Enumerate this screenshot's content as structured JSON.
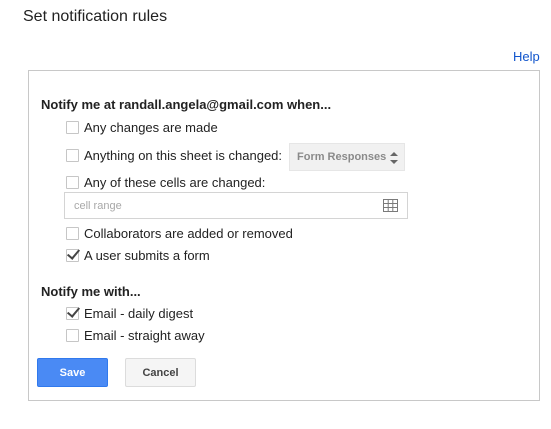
{
  "header": {
    "title": "Set notification rules",
    "help": "Help"
  },
  "notify_when": {
    "heading": "Notify me at randall.angela@gmail.com when...",
    "options": [
      {
        "label": "Any changes are made",
        "checked": false
      },
      {
        "label": "Anything on this sheet is changed:",
        "checked": false
      },
      {
        "label": "Any of these cells are changed:",
        "checked": false
      },
      {
        "label": "Collaborators are added or removed",
        "checked": false
      },
      {
        "label": "A user submits a form",
        "checked": true
      }
    ],
    "sheet_select": {
      "value": "Form Responses"
    },
    "cell_range": {
      "placeholder": "cell range",
      "value": ""
    }
  },
  "notify_with": {
    "heading": "Notify me with...",
    "options": [
      {
        "label": "Email - daily digest",
        "checked": true
      },
      {
        "label": "Email - straight away",
        "checked": false
      }
    ]
  },
  "buttons": {
    "save": "Save",
    "cancel": "Cancel"
  },
  "colors": {
    "primary": "#4a8af4",
    "link": "#1155cc"
  },
  "icons": {
    "select_arrows": "up-down-arrows-icon",
    "range": "grid-icon"
  }
}
